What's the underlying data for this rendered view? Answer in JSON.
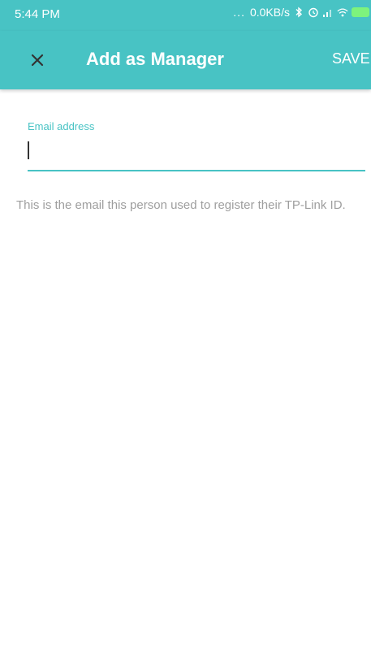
{
  "status_bar": {
    "time": "5:44 PM",
    "dots": "...",
    "network_speed": "0.0KB/s",
    "icons": [
      "bluetooth-icon",
      "alarm-icon",
      "signal-icon",
      "wifi-icon",
      "battery-charging-icon"
    ]
  },
  "app_bar": {
    "close_icon": "close-icon",
    "title": "Add as Manager",
    "save_label": "SAVE"
  },
  "form": {
    "email_label": "Email address",
    "email_value": "",
    "helper_text": "This is the email this person used to register their TP-Link ID."
  },
  "colors": {
    "accent": "#48c3c4",
    "helper_text": "#9e9e9e"
  }
}
